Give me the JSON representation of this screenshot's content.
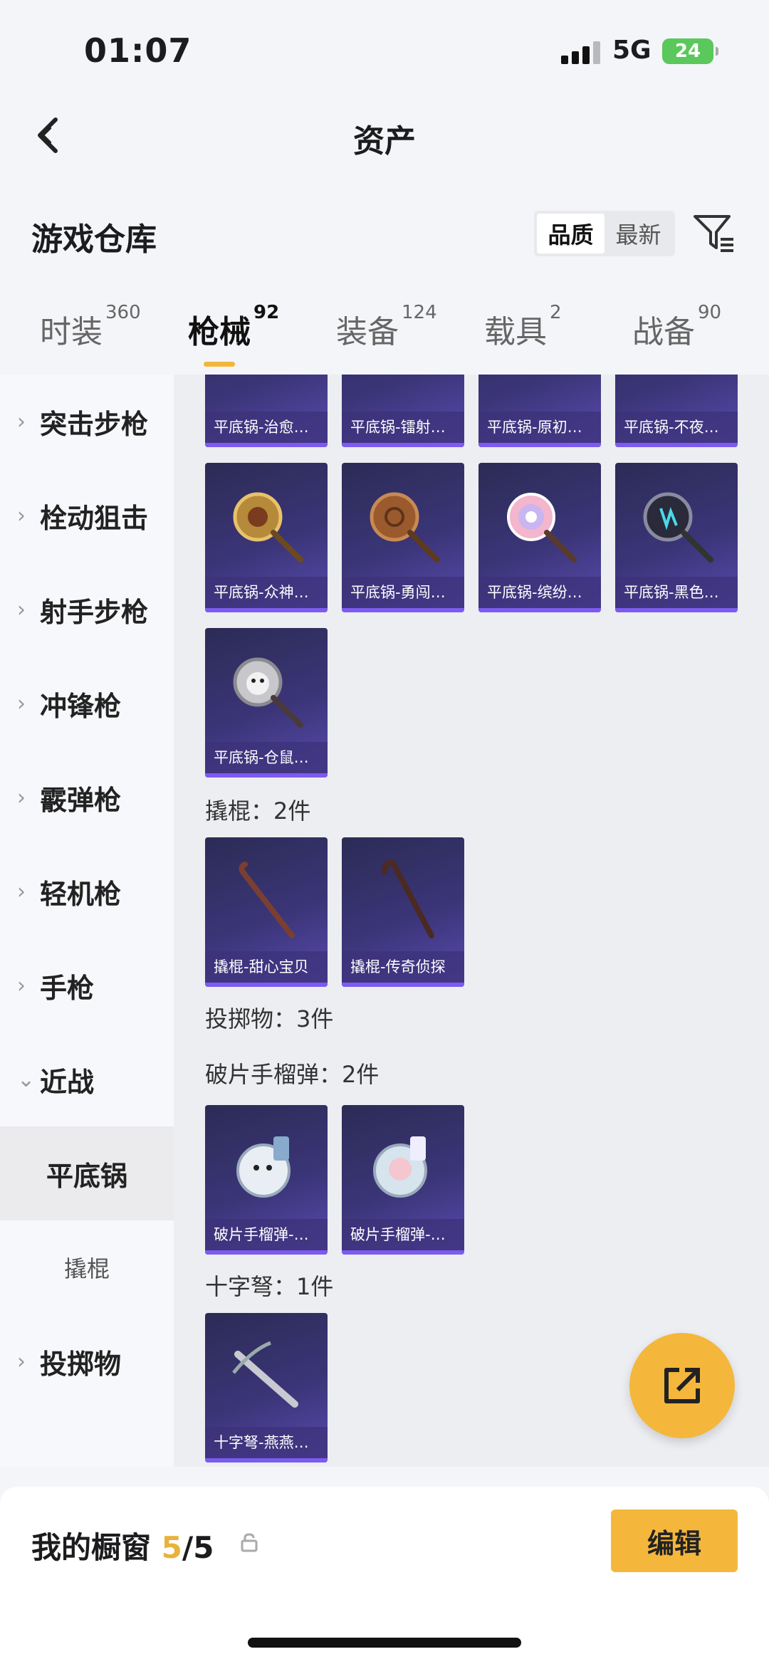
{
  "status": {
    "time": "01:07",
    "network": "5G",
    "battery": "24"
  },
  "nav": {
    "title": "资产"
  },
  "header": {
    "section_title": "游戏仓库",
    "sort": [
      "品质",
      "最新"
    ]
  },
  "tabs": [
    {
      "label": "时装",
      "count": "360"
    },
    {
      "label": "枪械",
      "count": "92"
    },
    {
      "label": "装备",
      "count": "124"
    },
    {
      "label": "载具",
      "count": "2"
    },
    {
      "label": "战备",
      "count": "90"
    }
  ],
  "sidebar": {
    "items": [
      "突击步枪",
      "栓动狙击",
      "射手步枪",
      "冲锋枪",
      "霰弹枪",
      "轻机枪",
      "手枪",
      "近战"
    ],
    "sub_selected": "平底锅",
    "sub_other": "撬棍",
    "last": "投掷物"
  },
  "cards_top": [
    "平底锅-治愈…",
    "平底锅-镭射…",
    "平底锅-原初…",
    "平底锅-不夜…"
  ],
  "cards_row2": [
    "平底锅-众神…",
    "平底锅-勇闯…",
    "平底锅-缤纷…",
    "平底锅-黑色…"
  ],
  "cards_row3": [
    "平底锅-仓鼠…"
  ],
  "groups": {
    "crowbar": "撬棍：2件",
    "throwable": "投掷物：3件",
    "frag": "破片手榴弹：2件",
    "crossbow": "十字弩：1件"
  },
  "cards_crowbar": [
    "撬棍-甜心宝贝",
    "撬棍-传奇侦探"
  ],
  "cards_frag": [
    "破片手榴弹-…",
    "破片手榴弹-…"
  ],
  "cards_crossbow": [
    "十字弩-燕燕…"
  ],
  "bottom": {
    "showcase_label": "我的橱窗",
    "showcase_current": "5",
    "showcase_total": "/5",
    "edit": "编辑"
  },
  "icons": {
    "back": "chevron-left-icon",
    "filter": "filter-icon",
    "fab": "share-icon",
    "lock": "lock-icon"
  },
  "colors": {
    "accent": "#f4b73c",
    "card": "#3b3578"
  }
}
